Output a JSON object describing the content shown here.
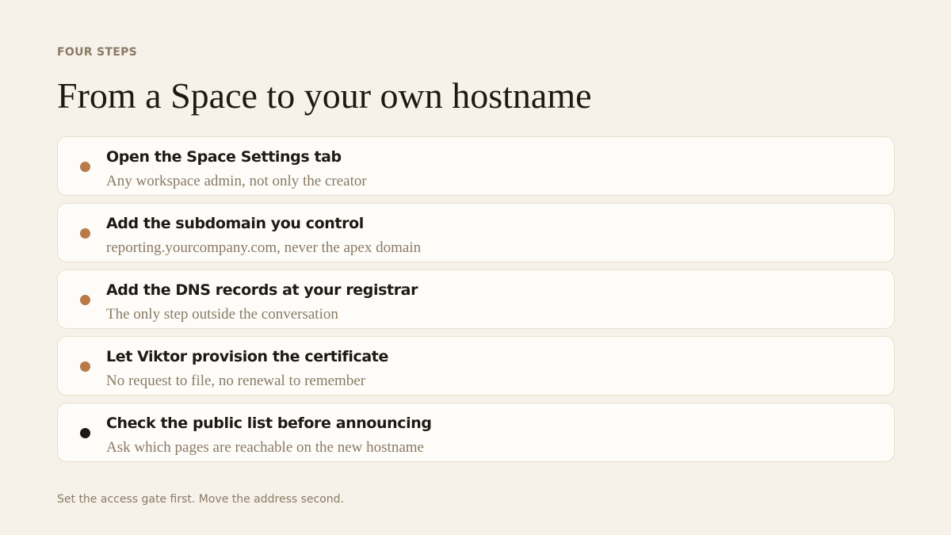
{
  "eyebrow": "FOUR STEPS",
  "title": "From a Space to your own hostname",
  "steps": [
    {
      "title": "Open the Space Settings tab",
      "subtitle": "Any workspace admin, not only the creator",
      "marker_color": "#b87a48"
    },
    {
      "title": "Add the subdomain you control",
      "subtitle": "reporting.yourcompany.com, never the apex domain",
      "marker_color": "#b87a48"
    },
    {
      "title": "Add the DNS records at your registrar",
      "subtitle": "The only step outside the conversation",
      "marker_color": "#b87a48"
    },
    {
      "title": "Let Viktor provision the certificate",
      "subtitle": "No request to file, no renewal to remember",
      "marker_color": "#b87a48"
    },
    {
      "title": "Check the public list before announcing",
      "subtitle": "Ask which pages are reachable on the new hostname",
      "marker_color": "#1c1a17"
    }
  ],
  "footnote": "Set the access gate first. Move the address second.",
  "colors": {
    "background": "#f6f2e9",
    "card": "#fdfcf8",
    "card_border": "#e8e0cf",
    "accent": "#b87a48",
    "text_primary": "#1d1a15",
    "text_muted": "#8a7a66"
  }
}
